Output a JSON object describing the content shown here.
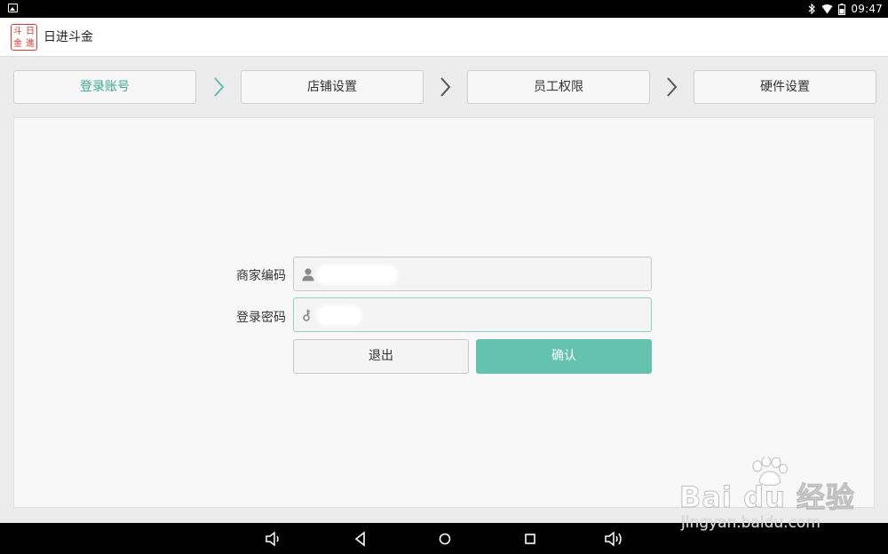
{
  "status_bar": {
    "time": "09:47"
  },
  "app": {
    "logo_chars": [
      "斗",
      "日",
      "金",
      "進"
    ],
    "title": "日进斗金"
  },
  "steps": [
    {
      "label": "登录账号",
      "active": true
    },
    {
      "label": "店铺设置",
      "active": false
    },
    {
      "label": "员工权限",
      "active": false
    },
    {
      "label": "硬件设置",
      "active": false
    }
  ],
  "form": {
    "merchant_code_label": "商家编码",
    "password_label": "登录密码",
    "exit_label": "退出",
    "confirm_label": "确认"
  },
  "watermark": {
    "brand": "Bai du 经验",
    "url": "jingyan.baidu.com"
  },
  "colors": {
    "accent": "#64c3ae",
    "active_text": "#3aaa93",
    "logo": "#e3342f"
  }
}
